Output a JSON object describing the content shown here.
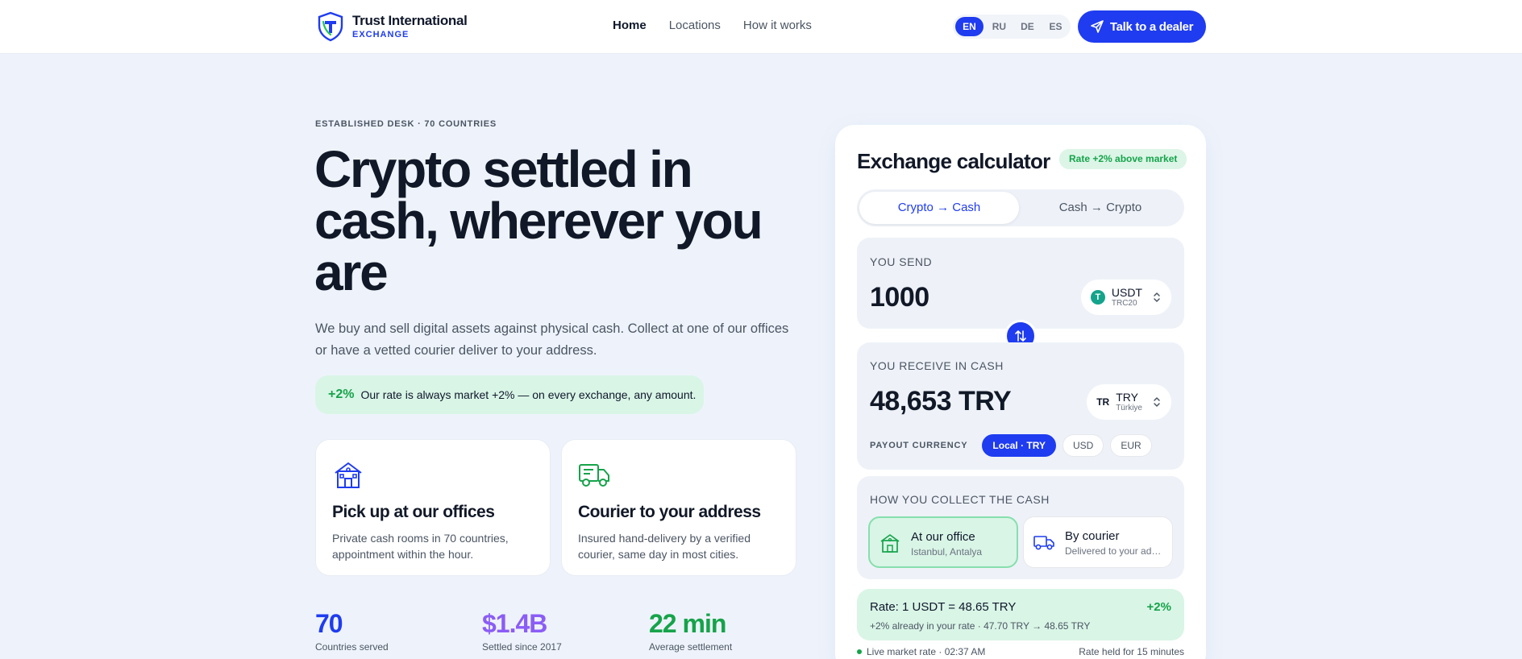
{
  "header": {
    "brand_name": "Trust International",
    "brand_sub": "EXCHANGE",
    "nav": [
      "Home",
      "Locations",
      "How it works"
    ],
    "languages": [
      "EN",
      "RU",
      "DE",
      "ES"
    ],
    "active_language": "EN",
    "dealer_button": "Talk to a dealer"
  },
  "hero": {
    "eyebrow": "ESTABLISHED DESK · 70 COUNTRIES",
    "title": "Crypto settled in cash, wherever you are",
    "description": "We buy and sell digital assets against physical cash. Collect at one of our offices or have a vetted courier deliver to your address.",
    "rate_pct": "+2%",
    "rate_text": "Our rate is always market +2% — on every exchange, any amount."
  },
  "features": [
    {
      "title": "Pick up at our offices",
      "desc": "Private cash rooms in 70 countries, appointment within the hour.",
      "icon": "building-icon"
    },
    {
      "title": "Courier to your address",
      "desc": "Insured hand-delivery by a verified courier, same day in most cities.",
      "icon": "truck-icon"
    }
  ],
  "stats": [
    {
      "value": "70",
      "label": "Countries served",
      "color": "#1f3cf0"
    },
    {
      "value": "$1.4B",
      "label": "Settled since 2017",
      "color": "#8b5cf6"
    },
    {
      "value": "22 min",
      "label": "Average settlement",
      "color": "#16a34a"
    }
  ],
  "calculator": {
    "title": "Exchange calculator",
    "badge": "Rate +2% above market",
    "tabs": [
      "Crypto → Cash",
      "Cash → Crypto"
    ],
    "send": {
      "label": "YOU SEND",
      "amount": "1000",
      "asset": "USDT",
      "network": "TRC20",
      "coin_glyph": "T"
    },
    "receive": {
      "label": "YOU RECEIVE IN CASH",
      "amount": "48,653 TRY",
      "currency": "TRY",
      "country": "Türkiye",
      "flag": "TR",
      "payout_label": "PAYOUT CURRENCY",
      "payout_options": [
        "Local · TRY",
        "USD",
        "EUR"
      ]
    },
    "collect": {
      "label": "HOW YOU COLLECT THE CASH",
      "options": [
        {
          "title": "At our office",
          "sub": "Istanbul, Antalya"
        },
        {
          "title": "By courier",
          "sub": "Delivered to your address"
        }
      ]
    },
    "rate": {
      "line": "Rate: 1 USDT = 48.65 TRY",
      "pct": "+2%",
      "detail": "+2% already in your rate · 47.70 TRY → 48.65 TRY"
    },
    "live": "Live market rate · 02:37 AM",
    "held": "Rate held for 15 minutes"
  }
}
